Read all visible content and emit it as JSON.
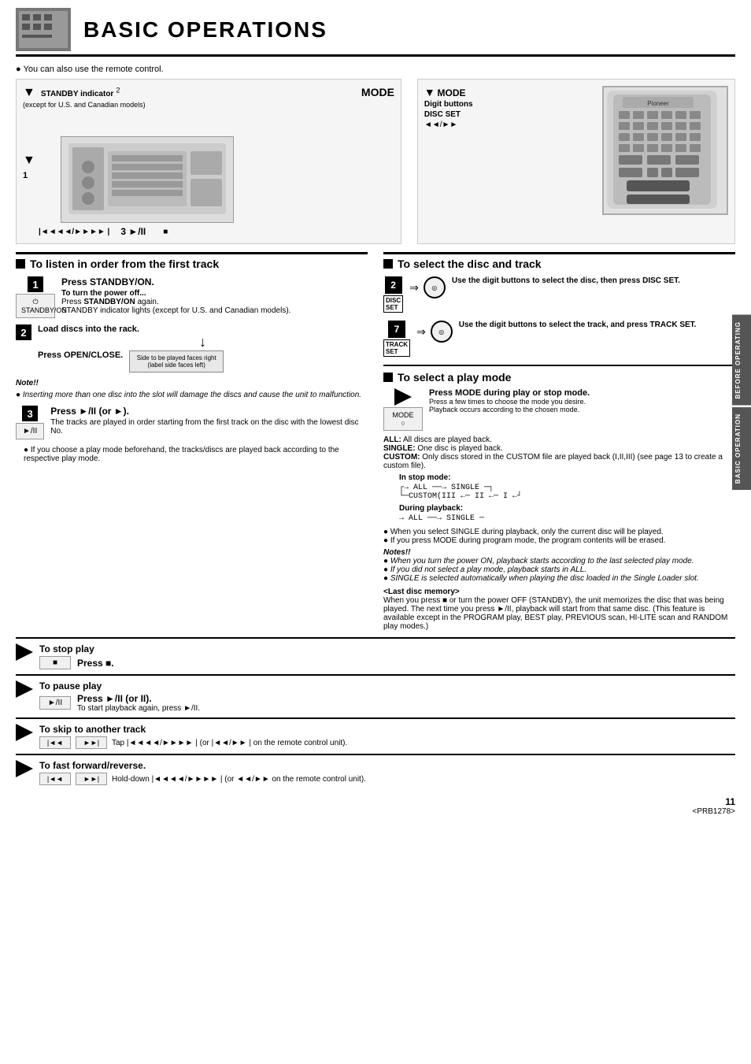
{
  "page": {
    "title": "BASIC OPERATIONS",
    "note_remote": "You can also use the remote control.",
    "standby_label": "STANDBY indicator",
    "standby_sub": "(except for U.S. and Canadian models)",
    "mode_label": "MODE",
    "digit_buttons": "Digit buttons",
    "disc_set": "DISC SET",
    "track_set": "TRACK SET",
    "section_left_title": "To listen in order from the first track",
    "section_right_title": "To select the disc and track",
    "step1_press": "Press STANDBY/ON.",
    "step1_sub1": "To turn the power off...",
    "step1_sub2": "Press STANDBY/ON again.",
    "step1_sub3": "STANDBY indicator lights (except for U.S. and Canadian models).",
    "step2_a": "Load discs into the rack.",
    "step2_b": "Press OPEN/CLOSE.",
    "step2_note": "Side to be played faces right (label side faces left)",
    "step3_press": "Press ►/II (or ►).",
    "step3_sub": "The tracks are played in order starting from the first track on the disc with the lowest disc No.",
    "play_mode_note": "If you choose a play mode beforehand, the tracks/discs are played back according to the respective play mode.",
    "to_stop_header": "To stop play",
    "to_stop_press": "Press ■.",
    "to_pause_header": "To pause play",
    "to_pause_press": "Press ►/II (or II).",
    "to_pause_sub": "To start playback again, press ►/II.",
    "to_skip_header": "To skip to another track",
    "to_skip_sub": "Tap |◄◄◄◄/►►►► | (or |◄◄/►► | on the remote control unit).",
    "to_fast_header": "To fast forward/reverse.",
    "to_fast_sub": "Hold-down |◄◄◄◄/►►►► | (or ◄◄/►► on the remote control unit).",
    "disc_track_title": "To select the disc and track",
    "disc_step_label": "DISC SET",
    "disc_step_desc": "Use the digit buttons to select the disc, then press DISC SET.",
    "track_step_label": "TRACK SET",
    "track_step_desc": "Use the digit buttons to select the track, and press TRACK SET.",
    "play_mode_title": "To select a play mode",
    "mode_press": "Press MODE during play or stop mode.",
    "mode_sub1": "Press a few times to choose the mode you desire.",
    "mode_sub2": "Playback occurs according to the chosen mode.",
    "all_label": "ALL:",
    "all_desc": "All discs are played back.",
    "single_label": "SINGLE:",
    "single_desc": "One disc is played back.",
    "custom_label": "CUSTOM:",
    "custom_desc": "Only discs stored in the CUSTOM file are played back (I,II,III)  (see page 13 to create a custom file).",
    "in_stop_label": "In stop mode:",
    "in_stop_flow": "→ ALL ——→ SINGLE ——  —CUSTOM(III ←— II ←— I ←",
    "during_playback_label": "During playback:",
    "during_playback_flow": "→ ALL ——→ SINGLE —",
    "bullet1": "When you select SINGLE during playback, only the current disc will be played.",
    "bullet2": "If you press MODE during program mode, the program contents will be erased.",
    "notes_title": "Notes!!",
    "note_italic1": "When you turn the power ON, playback starts according to the last selected play mode.",
    "note_italic2": "If you did not select a play mode, playback starts in ALL.",
    "note_italic3": "SINGLE is selected automatically when playing the disc loaded in the Single Loader slot.",
    "last_disc_title": "<Last disc memory>",
    "last_disc_text": "When you press ■ or turn the power OFF (STANDBY), the unit memorizes the disc that was being played. The next time you press ►/II, playback will start from that same disc. (This feature is available except in the PROGRAM play, BEST play, PREVIOUS scan, HI-LITE scan and RANDOM play modes.)",
    "page_number": "11",
    "prb_number": "<PRB1278>",
    "side_tab1": "BEFORE OPERATING",
    "side_tab2": "BASIC OPERATION",
    "note_double": "Note!!",
    "note_inserting": "Inserting more than one disc into the slot will damage the discs and cause the unit to malfunction."
  }
}
